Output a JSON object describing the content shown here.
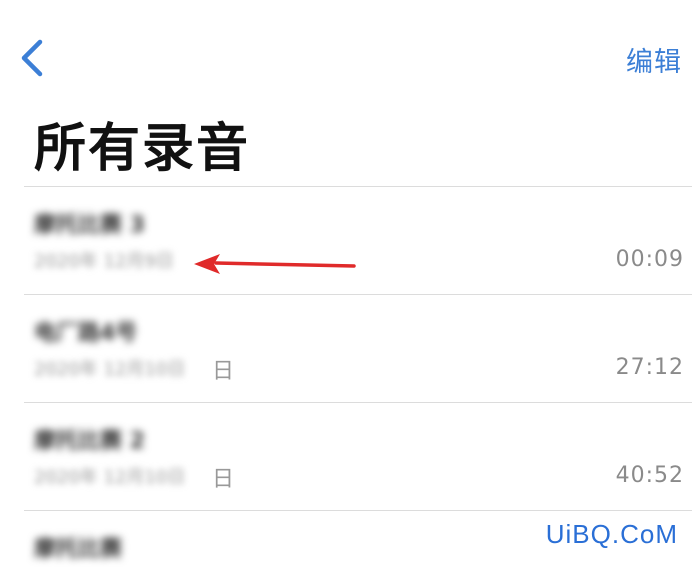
{
  "header": {
    "back_icon": "chevron-left-icon",
    "edit_label": "编辑",
    "title": "所有录音",
    "accent_color": "#3c7fd6"
  },
  "recordings": [
    {
      "name": "摩托比赛 3",
      "date": "2020年 12月9日",
      "date_tail": "",
      "duration": "00:09"
    },
    {
      "name": "电厂路4号",
      "date": "2020年 12月10日",
      "date_tail": "日",
      "duration": "27:12"
    },
    {
      "name": "摩托比赛 2",
      "date": "2020年 12月10日",
      "date_tail": "日",
      "duration": "40:52"
    },
    {
      "name": "摩托比赛",
      "date": "",
      "date_tail": "",
      "duration": ""
    }
  ],
  "annotation": {
    "arrow_color": "#e02a2a"
  },
  "watermark": "UiBQ.CoM"
}
